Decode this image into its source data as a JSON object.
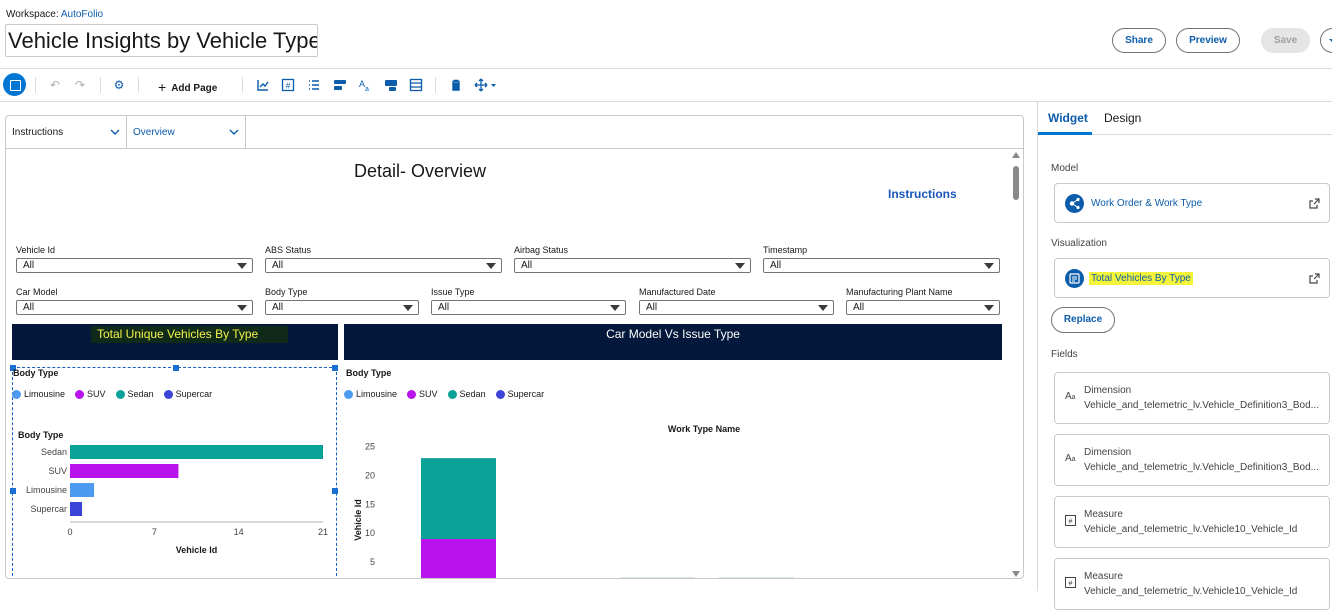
{
  "header": {
    "workspace_label": "Workspace:",
    "workspace_name": "AutoFolio",
    "title": "Vehicle Insights by Vehicle Type",
    "buttons": {
      "share": "Share",
      "preview": "Preview",
      "save": "Save"
    }
  },
  "toolbar": {
    "add_page": "Add Page",
    "icons": [
      "mode-toggle-icon",
      "undo-icon",
      "redo-icon",
      "settings-icon",
      "chart-icon",
      "number-icon",
      "list-icon",
      "container-icon",
      "text-icon",
      "image-icon",
      "table-icon",
      "delete-icon",
      "move-icon"
    ]
  },
  "pages": {
    "tabs": [
      {
        "label": "Instructions"
      },
      {
        "label": "Overview"
      }
    ]
  },
  "canvas": {
    "title": "Detail- Overview",
    "instructions_link": "Instructions",
    "filters_row1": [
      {
        "label": "Vehicle Id",
        "value": "All"
      },
      {
        "label": "ABS Status",
        "value": "All"
      },
      {
        "label": "Airbag Status",
        "value": "All"
      },
      {
        "label": "Timestamp",
        "value": "All"
      }
    ],
    "filters_row2": [
      {
        "label": "Car Model",
        "value": "All"
      },
      {
        "label": "Body Type",
        "value": "All"
      },
      {
        "label": "Issue Type",
        "value": "All"
      },
      {
        "label": "Manufactured Date",
        "value": "All"
      },
      {
        "label": "Manufacturing Plant Name",
        "value": "All"
      }
    ],
    "left_banner": "Total Unique Vehicles By Type",
    "right_banner": "Car Model Vs Issue Type",
    "legend_title": "Body Type",
    "legend": [
      {
        "name": "Limousine",
        "color": "#4c9bf0"
      },
      {
        "name": "SUV",
        "color": "#b813ea"
      },
      {
        "name": "Sedan",
        "color": "#0aa196"
      },
      {
        "name": "Supercar",
        "color": "#3b44d6"
      }
    ]
  },
  "chart_data": [
    {
      "type": "bar",
      "orientation": "horizontal",
      "ylabel": "Body Type",
      "xlabel": "Vehicle Id",
      "categories": [
        "Sedan",
        "SUV",
        "Limousine",
        "Supercar"
      ],
      "values": [
        21,
        9,
        2,
        1
      ],
      "colors": [
        "#0aa196",
        "#b813ea",
        "#4c9bf0",
        "#3b44d6"
      ],
      "xlim": [
        0,
        21
      ],
      "xticks": [
        0,
        7,
        14,
        21
      ],
      "legend": "top-left"
    },
    {
      "type": "bar",
      "stacked": true,
      "title": "Work Type Name",
      "ylabel": "Vehicle Id",
      "yticks": [
        5,
        10,
        15,
        20,
        25
      ],
      "ylim": [
        0,
        25
      ],
      "series": [
        {
          "name": "Sedan",
          "values": [
            14,
            0,
            0,
            0
          ],
          "color": "#0aa196"
        },
        {
          "name": "SUV",
          "values": [
            9,
            0,
            0,
            0
          ],
          "color": "#b813ea"
        },
        {
          "name": "Supercar",
          "values": [
            0,
            1,
            0,
            0
          ],
          "color": "#3b44d6"
        }
      ],
      "legend": "top-left"
    }
  ],
  "right_panel": {
    "tabs": {
      "widget": "Widget",
      "design": "Design"
    },
    "model_label": "Model",
    "model_name": "Work Order & Work Type",
    "visualization_label": "Visualization",
    "visualization_name": "Total Vehicles By Type",
    "replace_button": "Replace",
    "fields_label": "Fields",
    "fields": [
      {
        "type": "Dimension",
        "name": "Vehicle_and_telemetric_lv.Vehicle_Definition3_Bod..."
      },
      {
        "type": "Dimension",
        "name": "Vehicle_and_telemetric_lv.Vehicle_Definition3_Bod..."
      },
      {
        "type": "Measure",
        "name": "Vehicle_and_telemetric_lv.Vehicle10_Vehicle_Id"
      },
      {
        "type": "Measure",
        "name": "Vehicle_and_telemetric_lv.Vehicle10_Vehicle_Id"
      }
    ]
  }
}
